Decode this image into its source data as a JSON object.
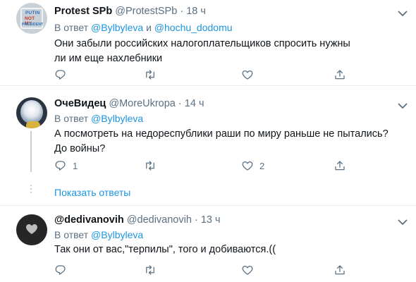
{
  "tweets": [
    {
      "name": "Protest SPb",
      "handle": "@ProtestSPb",
      "time": "18 ч",
      "reply_prefix": "В ответ",
      "mentions": [
        "@Bylbyleva",
        "@hochu_dodomu"
      ],
      "mention_joiner": "и",
      "text": "Они забыли российских налогоплательщиков спросить нужны ли им еще нахлебники",
      "avatar_text": [
        "PUTIN",
        "NOT MY",
        "PRESIDENT"
      ],
      "reply_count": "",
      "like_count": ""
    },
    {
      "name": "ОчеВидец",
      "handle": "@MoreUkropa",
      "time": "14 ч",
      "reply_prefix": "В ответ",
      "mentions": [
        "@Bylbyleva"
      ],
      "text": "А посмотреть на недореспублики раши по миру раньше не пытались? До войны?",
      "reply_count": "1",
      "like_count": "2"
    },
    {
      "name": "@dedivanovih",
      "handle": "@dedivanovih",
      "time": "13 ч",
      "reply_prefix": "В ответ",
      "mentions": [
        "@Bylbyleva"
      ],
      "text": "Так они от вас,\"терпилы\", того и добиваются.((",
      "reply_count": "",
      "like_count": ""
    }
  ],
  "show_replies": "Показать ответы",
  "separator_dot": "·",
  "colors": {
    "link": "#1b95e0",
    "muted": "#5b7083",
    "text": "#0f1419",
    "divider": "#e6ecf0"
  },
  "icons": [
    "caret-down-icon",
    "reply-icon",
    "retweet-icon",
    "like-icon",
    "share-icon"
  ]
}
